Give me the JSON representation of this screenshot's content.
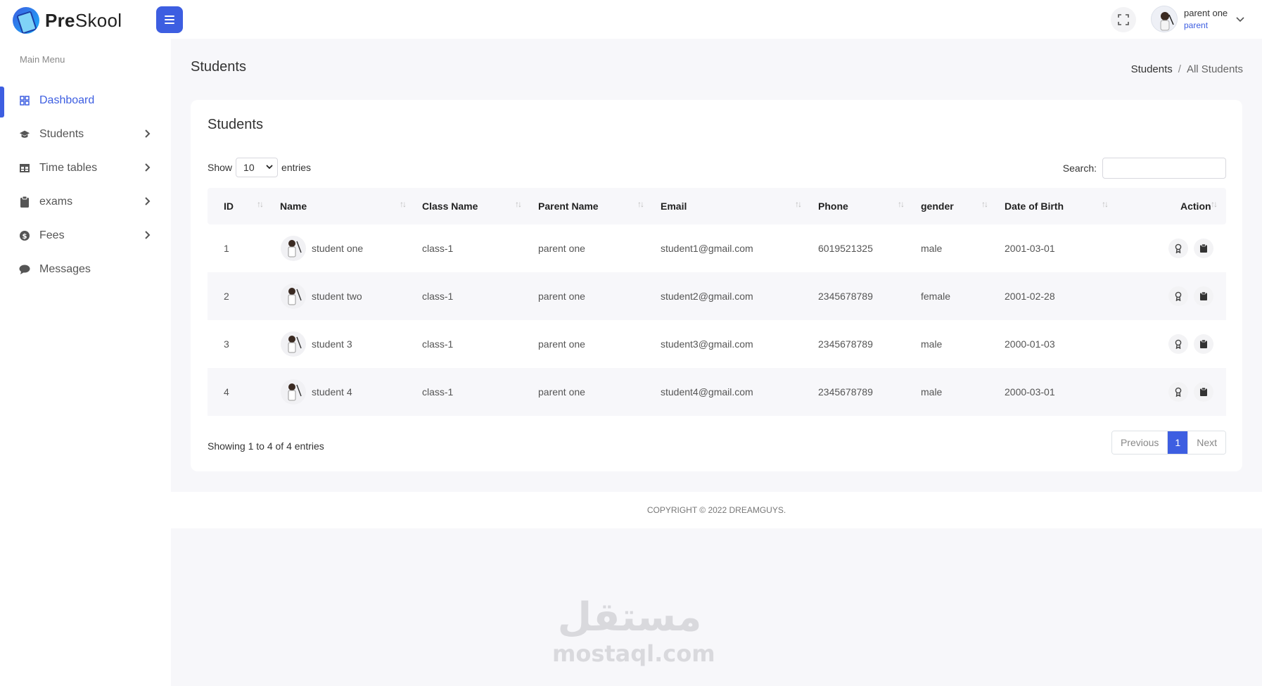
{
  "header": {
    "logo_prefix": "Pre",
    "logo_suffix": "Skool",
    "user_name": "parent one",
    "user_role": "parent"
  },
  "sidebar": {
    "menu_title": "Main Menu",
    "items": [
      {
        "label": "Dashboard",
        "icon": "grid-icon",
        "active": true,
        "has_submenu": false
      },
      {
        "label": "Students",
        "icon": "graduation-cap-icon",
        "active": false,
        "has_submenu": true
      },
      {
        "label": "Time tables",
        "icon": "table-icon",
        "active": false,
        "has_submenu": true
      },
      {
        "label": "exams",
        "icon": "clipboard-icon",
        "active": false,
        "has_submenu": true
      },
      {
        "label": "Fees",
        "icon": "coins-icon",
        "active": false,
        "has_submenu": true
      },
      {
        "label": "Messages",
        "icon": "message-icon",
        "active": false,
        "has_submenu": false
      }
    ]
  },
  "page": {
    "title": "Students",
    "breadcrumb": [
      "Students",
      "/",
      "All Students"
    ]
  },
  "card": {
    "title": "Students",
    "show_label": "Show",
    "entries_label": "entries",
    "page_size": "10",
    "search_label": "Search:",
    "search_value": "",
    "columns": [
      "ID",
      "Name",
      "Class Name",
      "Parent Name",
      "Email",
      "Phone",
      "gender",
      "Date of Birth",
      "Action"
    ],
    "rows": [
      {
        "id": "1",
        "name": "student one",
        "class": "class-1",
        "parent": "parent one",
        "email": "student1@gmail.com",
        "phone": "6019521325",
        "gender": "male",
        "dob": "2001-03-01"
      },
      {
        "id": "2",
        "name": "student two",
        "class": "class-1",
        "parent": "parent one",
        "email": "student2@gmail.com",
        "phone": "2345678789",
        "gender": "female",
        "dob": "2001-02-28"
      },
      {
        "id": "3",
        "name": "student 3",
        "class": "class-1",
        "parent": "parent one",
        "email": "student3@gmail.com",
        "phone": "2345678789",
        "gender": "male",
        "dob": "2000-01-03"
      },
      {
        "id": "4",
        "name": "student 4",
        "class": "class-1",
        "parent": "parent one",
        "email": "student4@gmail.com",
        "phone": "2345678789",
        "gender": "male",
        "dob": "2000-03-01"
      }
    ],
    "info": "Showing 1 to 4 of 4 entries",
    "pagination": {
      "previous": "Previous",
      "current": "1",
      "next": "Next"
    }
  },
  "footer": {
    "copyright": "COPYRIGHT © 2022 DREAMGUYS."
  },
  "watermark": {
    "arabic": "مستقل",
    "latin": "mostaql.com"
  },
  "colors": {
    "accent": "#3d5ee1",
    "page_bg": "#f7f7fa"
  }
}
